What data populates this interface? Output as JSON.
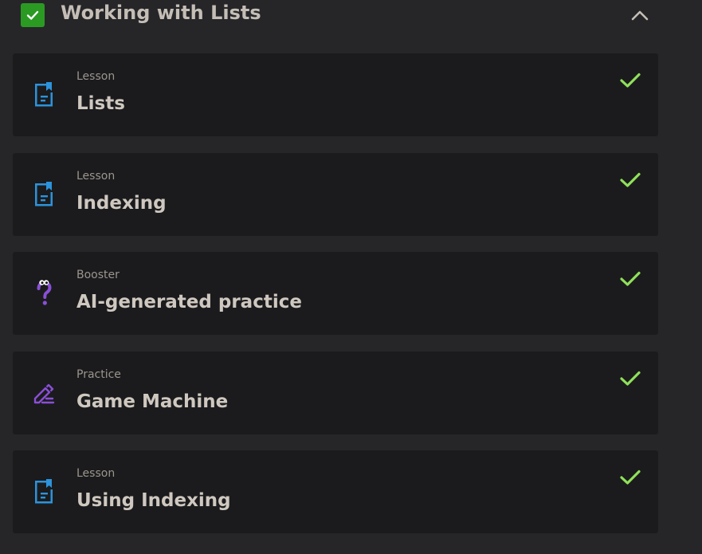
{
  "section": {
    "title": "Working with Lists",
    "completed": true,
    "expanded": true
  },
  "colors": {
    "background": "#262629",
    "card": "#1b1b1d",
    "complete_green": "#8fe05a",
    "checkbox_green": "#2b9a22",
    "lesson_blue": "#2c93dc",
    "booster_purple": "#8a4fd6",
    "practice_purple": "#8a4fd6"
  },
  "items": [
    {
      "type": "Lesson",
      "title": "Lists",
      "icon": "lesson-document-icon",
      "completed": true
    },
    {
      "type": "Lesson",
      "title": "Indexing",
      "icon": "lesson-document-icon",
      "completed": true
    },
    {
      "type": "Booster",
      "title": "AI-generated practice",
      "icon": "booster-question-icon",
      "completed": true
    },
    {
      "type": "Practice",
      "title": "Game Machine",
      "icon": "practice-pencil-icon",
      "completed": true
    },
    {
      "type": "Lesson",
      "title": "Using Indexing",
      "icon": "lesson-document-icon",
      "completed": true
    }
  ]
}
